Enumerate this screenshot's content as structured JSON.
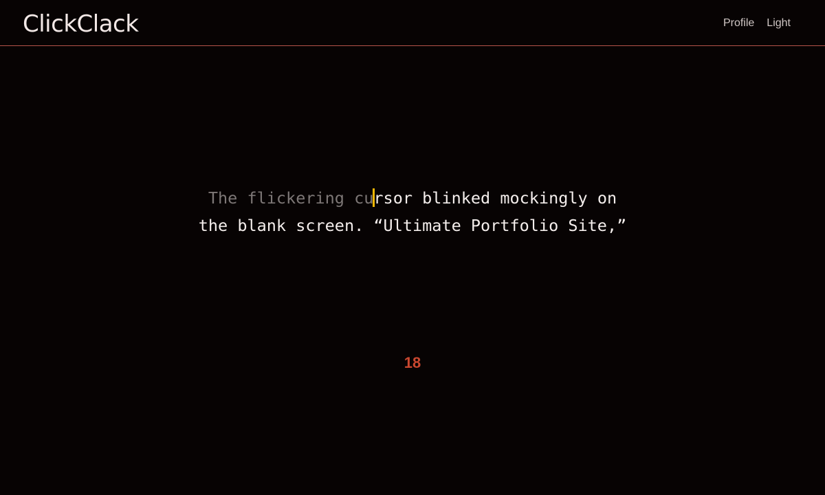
{
  "app": {
    "logo": "ClickClack"
  },
  "nav": {
    "profile_label": "Profile",
    "theme_label": "Light"
  },
  "typing": {
    "typed_text": "The flickering cu",
    "remaining_line1": "rsor blinked mockingly on",
    "line2": "the blank screen. “Ultimate Portfolio Site,”"
  },
  "stats": {
    "count": "18"
  },
  "colors": {
    "background": "#070303",
    "accent": "#c9472f",
    "caret": "#f2b705",
    "divider": "#b5544a",
    "typed_text": "#7d7776",
    "untyped_text": "#f4eeec"
  }
}
